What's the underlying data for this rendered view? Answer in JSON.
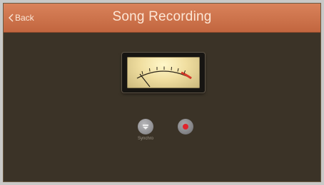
{
  "navbar": {
    "back_label": "Back",
    "title": "Song Recording",
    "back_icon": "chevron-left-icon"
  },
  "meter": {
    "icon": "vu-meter",
    "needle_level": 0.12
  },
  "controls": {
    "synchro_label": "Synchro",
    "synchro_icon": "synchro-icon",
    "record_icon": "record-icon"
  },
  "colors": {
    "navbar": "#c9704a",
    "background": "#3b3327",
    "record": "#e0242c"
  }
}
